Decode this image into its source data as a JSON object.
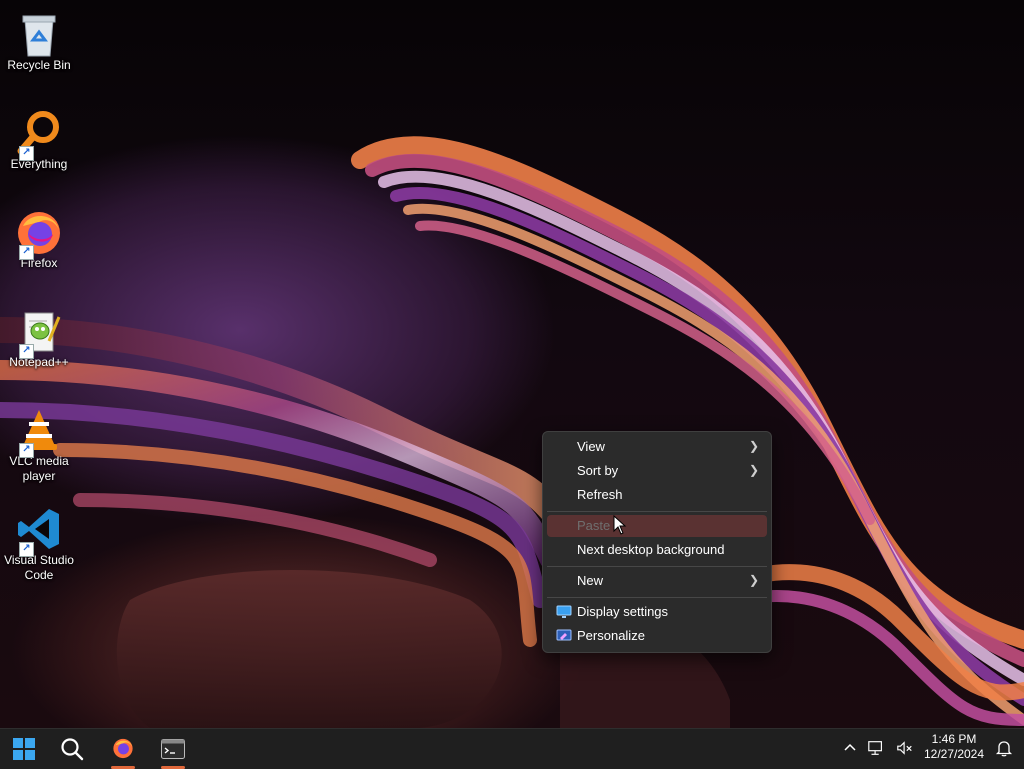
{
  "desktop": {
    "icons": [
      {
        "label": "Recycle Bin",
        "icon": "recycle-bin-icon"
      },
      {
        "label": "Everything",
        "icon": "everything-search-icon"
      },
      {
        "label": "Firefox",
        "icon": "firefox-icon"
      },
      {
        "label": "Notepad++",
        "icon": "notepad-plus-plus-icon"
      },
      {
        "label": "VLC media player",
        "icon": "vlc-icon"
      },
      {
        "label": "Visual Studio Code",
        "icon": "vscode-icon"
      }
    ]
  },
  "context_menu": {
    "view": "View",
    "sort_by": "Sort by",
    "refresh": "Refresh",
    "paste": "Paste",
    "next_background": "Next desktop background",
    "new": "New",
    "display_settings": "Display settings",
    "personalize": "Personalize"
  },
  "taskbar": {
    "time": "1:46 PM",
    "date": "12/27/2024",
    "apps": [
      "start-icon",
      "search-icon",
      "firefox-icon",
      "terminal-icon"
    ]
  },
  "colors": {
    "accent": "#e0683b",
    "menu_bg": "#2b2b2b",
    "menu_hover": "#5a3232",
    "taskbar_bg": "#1f1f1f"
  }
}
